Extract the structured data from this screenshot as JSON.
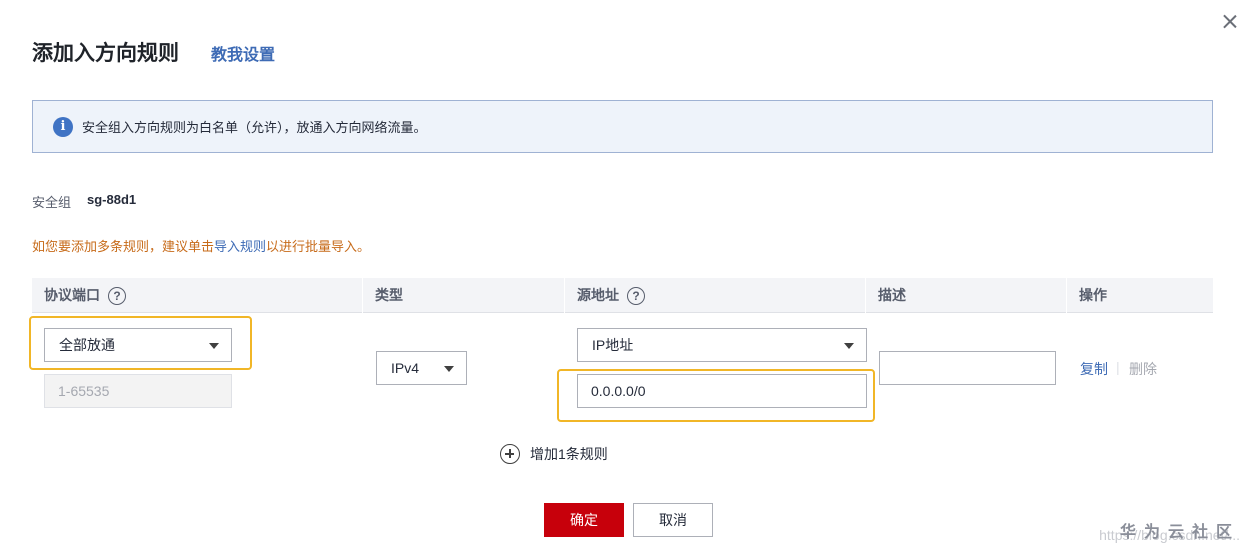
{
  "dialog": {
    "title": "添加入方向规则",
    "help_link": "教我设置"
  },
  "notice": {
    "icon": "info-icon",
    "text": "安全组入方向规则为白名单（允许），放通入方向网络流量。"
  },
  "security_group": {
    "label": "安全组",
    "value": "sg-88d1"
  },
  "hint": {
    "prefix": "如您要添加多条规则，建议单击",
    "link": "导入规则",
    "suffix": "以进行批量导入。"
  },
  "table": {
    "columns": {
      "protocol_port": "协议端口",
      "type": "类型",
      "source": "源地址",
      "description": "描述",
      "actions": "操作"
    },
    "row": {
      "protocol": "全部放通",
      "port_placeholder": "1-65535",
      "type": "IPv4",
      "source_type": "IP地址",
      "source_value": "0.0.0.0/0",
      "description": "",
      "copy": "复制",
      "separator": "|",
      "delete": "删除"
    }
  },
  "add_rule": "增加1条规则",
  "footer": {
    "ok": "确定",
    "cancel": "取消"
  },
  "watermark": {
    "url": "https://blog.csdn.net/...",
    "brand": "华为云社区"
  },
  "colors": {
    "primary_red": "#c7000b",
    "link_blue": "#3e6bb5",
    "highlight_yellow": "#f1b627",
    "hint_orange": "#c76b1a"
  }
}
